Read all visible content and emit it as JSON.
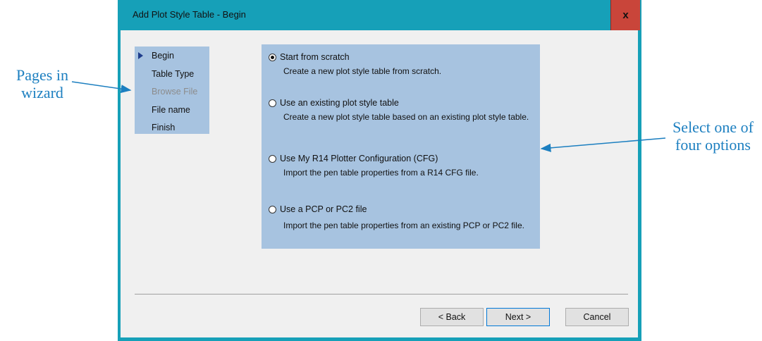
{
  "window": {
    "title": "Add Plot Style Table - Begin",
    "close_label": "x"
  },
  "nav": {
    "items": [
      {
        "label": "Begin",
        "current": true,
        "disabled": false
      },
      {
        "label": "Table Type",
        "current": false,
        "disabled": false
      },
      {
        "label": "Browse File",
        "current": false,
        "disabled": true
      },
      {
        "label": "File name",
        "current": false,
        "disabled": false
      },
      {
        "label": "Finish",
        "current": false,
        "disabled": false
      }
    ]
  },
  "options": [
    {
      "label": "Start from scratch",
      "description": "Create a new plot style table from scratch.",
      "checked": true
    },
    {
      "label": "Use an existing plot style table",
      "description": "Create a new plot style table based on an existing plot style table.",
      "checked": false
    },
    {
      "label": "Use My R14 Plotter Configuration (CFG)",
      "description": "Import the pen table properties from a R14 CFG file.",
      "checked": false
    },
    {
      "label": "Use a PCP or PC2 file",
      "description": "Import the pen table properties from an existing PCP or PC2 file.",
      "checked": false
    }
  ],
  "buttons": {
    "back": "< Back",
    "next": "Next >",
    "cancel": "Cancel"
  },
  "annotations": {
    "left": {
      "line1": "Pages in",
      "line2": "wizard"
    },
    "right": {
      "line1": "Select one of",
      "line2": "four options"
    }
  },
  "colors": {
    "accent": "#16a0b8",
    "close": "#c9453a",
    "highlight": "#a7c3e0",
    "annotation": "#1c7fc0"
  }
}
